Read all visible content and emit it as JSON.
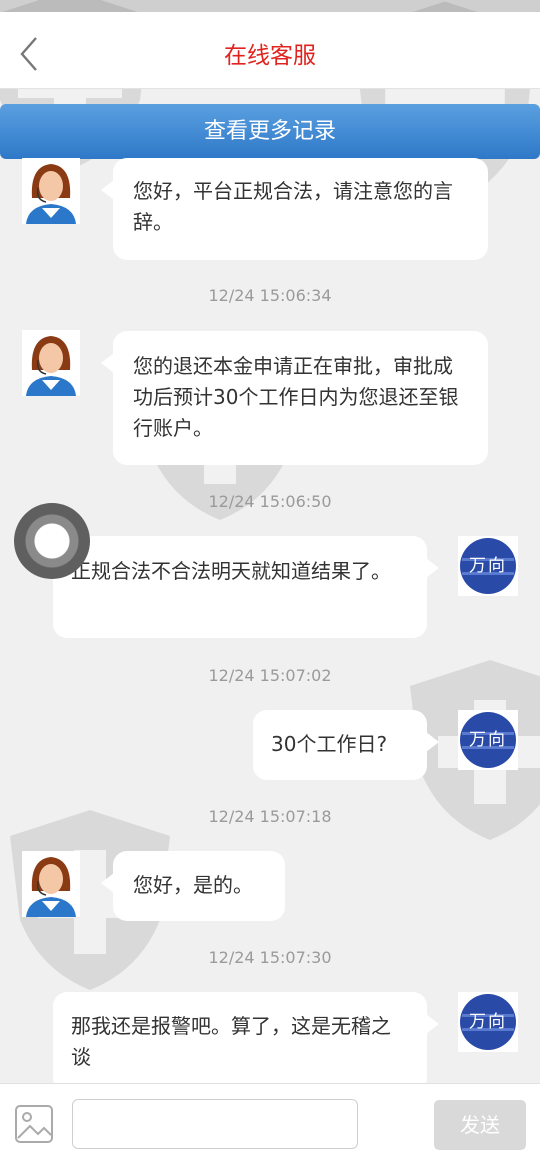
{
  "header": {
    "title": "在线客服"
  },
  "load_more_label": "查看更多记录",
  "messages": [
    {
      "side": "left",
      "text": "您好，平台正规合法，请注意您的言辞。"
    },
    {
      "timestamp": "12/24 15:06:34"
    },
    {
      "side": "left",
      "text": "您的退还本金申请正在审批，审批成功后预计30个工作日内为您退还至银行账户。"
    },
    {
      "timestamp": "12/24 15:06:50"
    },
    {
      "side": "right",
      "text": "正规合法不合法明天就知道结果了。"
    },
    {
      "timestamp": "12/24 15:07:02"
    },
    {
      "side": "right",
      "text": "30个工作日?"
    },
    {
      "timestamp": "12/24 15:07:18"
    },
    {
      "side": "left",
      "text": "您好，是的。"
    },
    {
      "timestamp": "12/24 15:07:30"
    },
    {
      "side": "right",
      "text": "那我还是报警吧。算了，这是无稽之谈"
    }
  ],
  "user_avatar_text": "万向",
  "input": {
    "placeholder": ""
  },
  "send_label": "发送",
  "colors": {
    "title": "#e0231e",
    "load_more_bg": "#3a86d4",
    "bubble": "#ffffff",
    "background": "#f0f0f0"
  }
}
